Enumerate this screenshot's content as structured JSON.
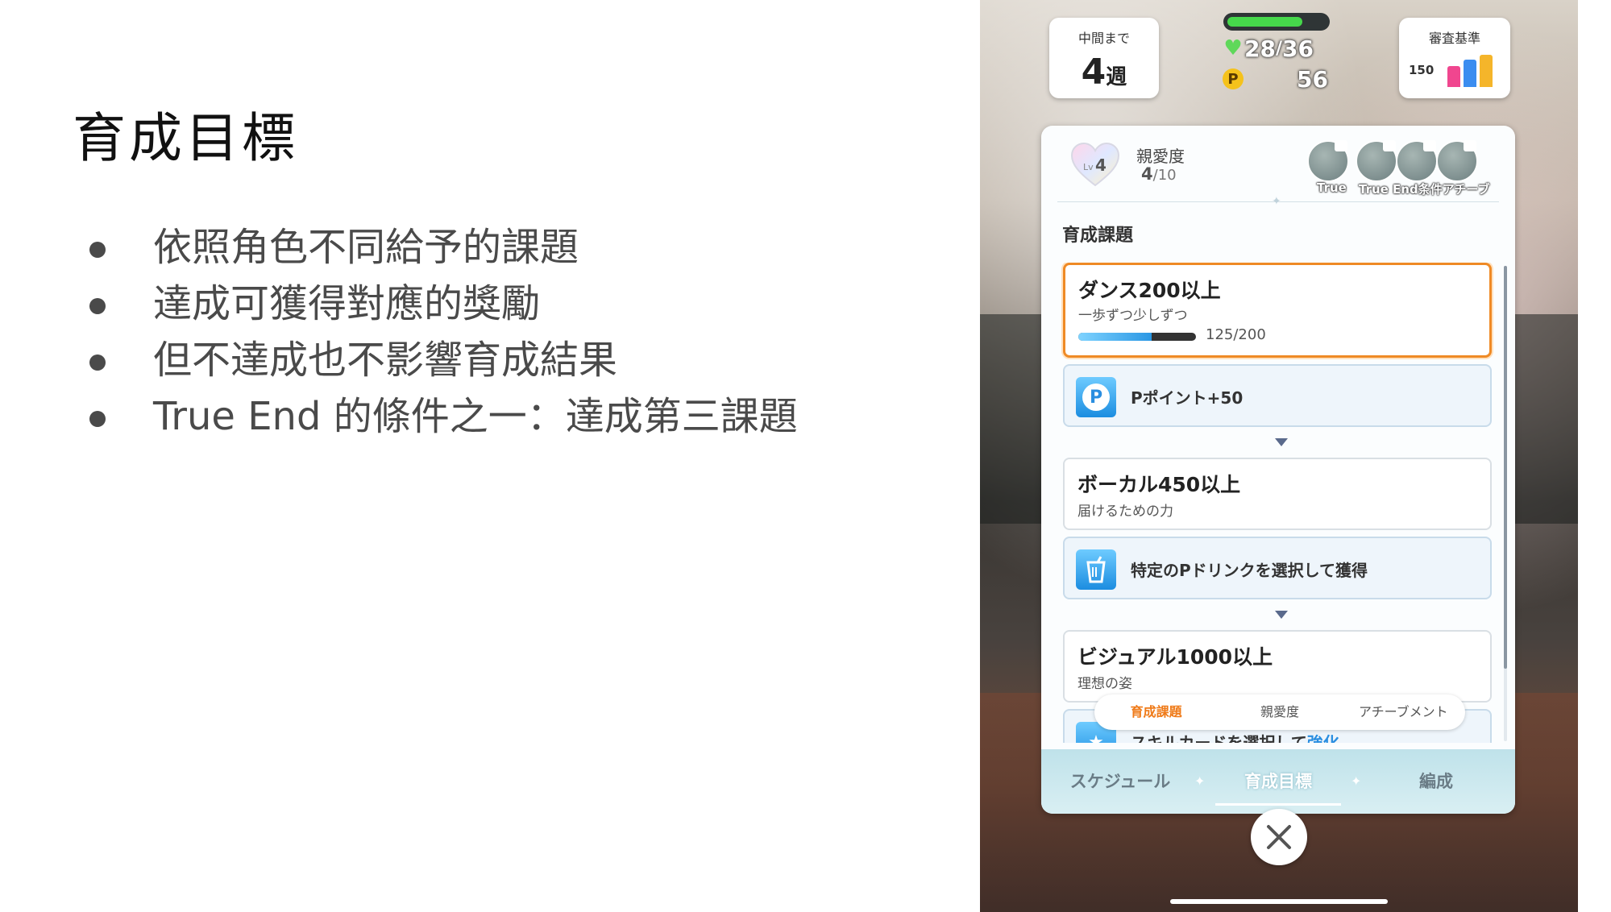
{
  "slide": {
    "title": "育成目標",
    "bullets": [
      "依照角色不同給予的課題",
      "達成可獲得對應的獎勵",
      "但不達成也不影響育成結果",
      "True End 的條件之一：達成第三課題"
    ]
  },
  "game": {
    "midterm": {
      "label": "中間まで",
      "value": "4",
      "unit": "週"
    },
    "stamina": {
      "current": "28",
      "max": "36",
      "fraction": 0.78
    },
    "points": "56",
    "judge": {
      "label": "審査基準",
      "value": "150",
      "colors": [
        "#f0468f",
        "#3b8df0",
        "#f5b52a"
      ]
    },
    "affection": {
      "badge": "Lv4",
      "label": "親愛度",
      "current": "4",
      "max": "10"
    },
    "achievements": {
      "label_true": "True",
      "label_cond": "True End条件アチーブ"
    },
    "section_title": "育成課題",
    "tasks": [
      {
        "name": "ダンス200以上",
        "sub": "一歩ずつ少しずつ",
        "progress": "125/200",
        "progress_fraction": 0.625
      },
      {
        "name": "ボーカル450以上",
        "sub": "届けるための力"
      },
      {
        "name": "ビジュアル1000以上",
        "sub": "理想の姿"
      }
    ],
    "rewards": [
      {
        "text": "Pポイント+50",
        "icon": "p-point-icon"
      },
      {
        "text": "特定のPドリンクを選択して獲得",
        "icon": "drink-icon"
      },
      {
        "text": "スキルカードを選択して",
        "highlight": "強化",
        "icon": "skill-card-icon"
      }
    ],
    "subtabs": [
      "育成課題",
      "親愛度",
      "アチーブメント"
    ],
    "bottom_tabs": [
      "スケジュール",
      "育成目標",
      "編成"
    ],
    "colors": {
      "accent": "#ef8a25",
      "reward_blue": "#2a97e4"
    }
  }
}
